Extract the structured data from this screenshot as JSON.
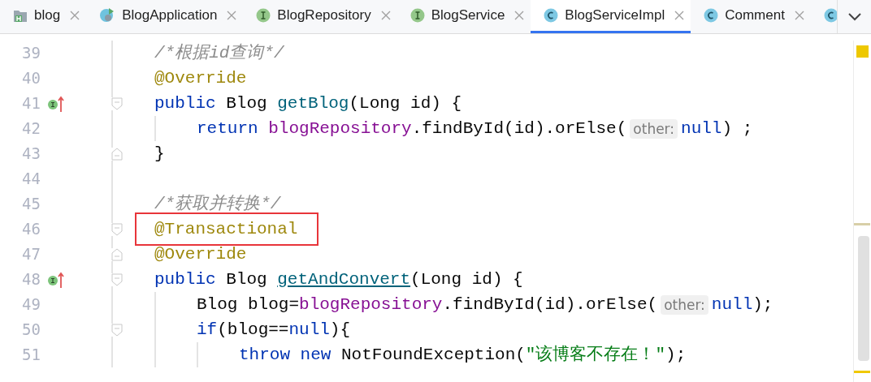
{
  "tabs": [
    {
      "label": "blog",
      "kind": "module",
      "selected": false
    },
    {
      "label": "BlogApplication",
      "kind": "app",
      "selected": false
    },
    {
      "label": "BlogRepository",
      "kind": "interface",
      "selected": false
    },
    {
      "label": "BlogService",
      "kind": "interface",
      "selected": false
    },
    {
      "label": "BlogServiceImpl",
      "kind": "class",
      "selected": true
    },
    {
      "label": "Comment",
      "kind": "class",
      "selected": false
    },
    {
      "kind": "class",
      "selected": false
    }
  ],
  "lines": [
    {
      "number": "39",
      "kind": "top",
      "implements": false,
      "fold_start": false,
      "fold_end": false,
      "tokens": [
        {
          "kind": "comment",
          "text": "/*根据id查询*/"
        }
      ]
    },
    {
      "number": "40",
      "kind": "top",
      "implements": false,
      "fold_start": false,
      "fold_end": false,
      "tokens": [
        {
          "kind": "annotation",
          "text": "@Override"
        }
      ]
    },
    {
      "number": "41",
      "kind": "top",
      "implements": true,
      "fold_start": true,
      "fold_end": false,
      "tokens": [
        {
          "kind": "keyword",
          "text": "public"
        },
        {
          "kind": "plain",
          "text": "Blog",
          "space": true
        },
        {
          "kind": "method",
          "text": "getBlog",
          "space": true
        },
        {
          "kind": "plain",
          "text": "(Long id) {"
        }
      ]
    },
    {
      "number": "42",
      "kind": "indented",
      "implements": false,
      "fold_start": false,
      "fold_end": false,
      "tokens": [
        {
          "kind": "keyword",
          "text": "return"
        },
        {
          "kind": "field",
          "text": "blogRepository",
          "space": true
        },
        {
          "kind": "plain",
          "text": ".findById(id).orElse("
        },
        {
          "kind": "hint",
          "text": "other:"
        },
        {
          "kind": "keyword",
          "text": "null"
        },
        {
          "kind": "plain",
          "text": ") ;"
        }
      ]
    },
    {
      "number": "43",
      "kind": "top",
      "implements": false,
      "fold_start": false,
      "fold_end": true,
      "tokens": [
        {
          "kind": "plain",
          "text": "}"
        }
      ]
    },
    {
      "number": "44",
      "kind": "top",
      "implements": false,
      "fold_start": false,
      "fold_end": false
    },
    {
      "number": "45",
      "kind": "top",
      "implements": false,
      "fold_start": false,
      "fold_end": false,
      "tokens": [
        {
          "kind": "comment",
          "text": "/*获取并转换*/"
        }
      ]
    },
    {
      "number": "46",
      "kind": "top",
      "implements": false,
      "fold_start": true,
      "fold_end": false,
      "tokens": [
        {
          "kind": "annotation",
          "text": "@Transactional",
          "boxed": true
        }
      ]
    },
    {
      "number": "47",
      "kind": "top",
      "implements": false,
      "fold_start": false,
      "fold_end": true,
      "tokens": [
        {
          "kind": "annotation",
          "text": "@Override"
        }
      ]
    },
    {
      "number": "48",
      "kind": "top",
      "implements": true,
      "fold_start": true,
      "fold_end": false,
      "tokens": [
        {
          "kind": "keyword",
          "text": "public"
        },
        {
          "kind": "plain",
          "text": "Blog",
          "space": true
        },
        {
          "kind": "link",
          "text": "getAndConvert",
          "space": true
        },
        {
          "kind": "plain",
          "text": "(Long id) {"
        }
      ]
    },
    {
      "number": "49",
      "kind": "indented",
      "implements": false,
      "fold_start": false,
      "fold_end": false,
      "tokens": [
        {
          "kind": "plain",
          "text": "Blog blog="
        },
        {
          "kind": "field",
          "text": "blogRepository"
        },
        {
          "kind": "plain",
          "text": ".findById(id).orElse("
        },
        {
          "kind": "hint",
          "text": "other:"
        },
        {
          "kind": "keyword",
          "text": "null"
        },
        {
          "kind": "plain",
          "text": ");"
        }
      ]
    },
    {
      "number": "50",
      "kind": "indented",
      "implements": false,
      "fold_start": true,
      "fold_end": false,
      "tokens": [
        {
          "kind": "keyword",
          "text": "if"
        },
        {
          "kind": "plain",
          "text": "(blog=="
        },
        {
          "kind": "keyword",
          "text": "null"
        },
        {
          "kind": "plain",
          "text": "){"
        }
      ]
    },
    {
      "number": "51",
      "kind": "nested",
      "implements": false,
      "fold_start": false,
      "fold_end": false,
      "tokens": [
        {
          "kind": "keyword",
          "text": "throw new"
        },
        {
          "kind": "plain",
          "text": "NotFoundException(",
          "space": true
        },
        {
          "kind": "string",
          "text": "\"该博客不存在！\""
        },
        {
          "kind": "plain",
          "text": ");"
        }
      ]
    }
  ]
}
